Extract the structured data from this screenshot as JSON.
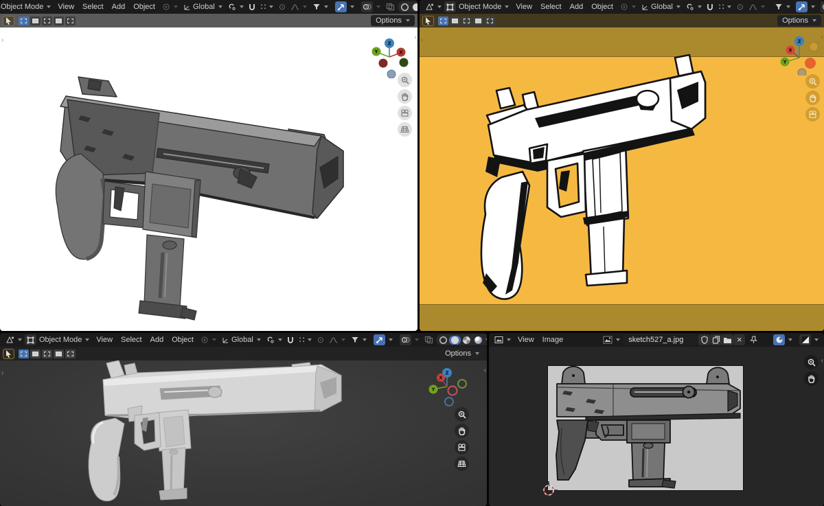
{
  "viewport": {
    "mode": "Object Mode",
    "view": "View",
    "select": "Select",
    "add": "Add",
    "object": "Object",
    "orientation": "Global",
    "options": "Options"
  },
  "image_editor": {
    "view": "View",
    "image": "Image",
    "name": "sketch527_a.jpg"
  },
  "gizmo": {
    "x": "X",
    "y": "Y",
    "z": "Z"
  },
  "icons": {
    "chevron_left": "‹",
    "chevron_right": "›",
    "snap_dots": "∷",
    "prop_dot": "⊙",
    "close_x": "×"
  },
  "colors": {
    "accent_blue": "#4772b3",
    "camera_inner": "#f5b942",
    "camera_outer": "#ab8a2e",
    "rendered_world": "#ffffff",
    "solid_viewport_bg": "#3a3a3a",
    "image_editor_bg": "#262626",
    "reference_image_bg": "#c9c9c9",
    "axis_x": "#e2493e",
    "axis_y": "#6fa21c",
    "axis_z": "#3b83bd"
  },
  "status": {
    "shading_top_left": "rendered",
    "shading_bottom_left": "solid",
    "camera_view": "top-right"
  }
}
